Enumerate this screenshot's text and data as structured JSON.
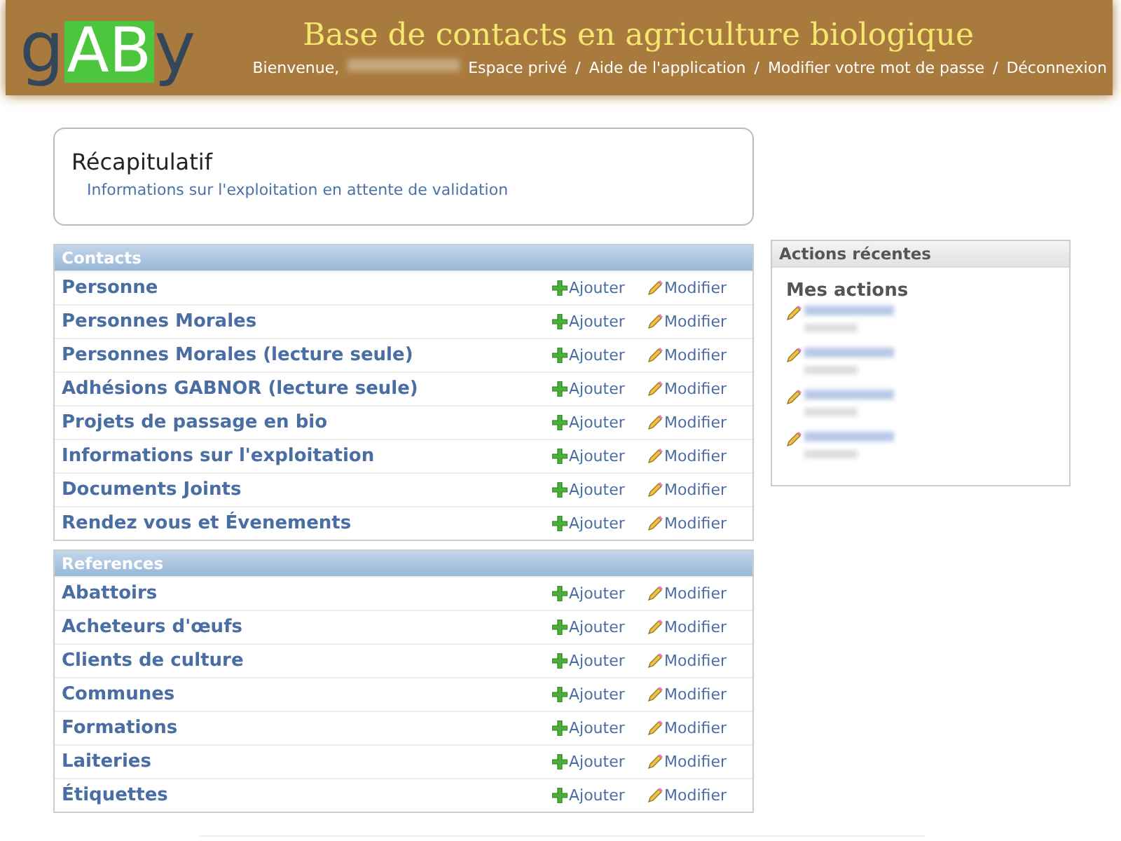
{
  "header": {
    "logo": {
      "letters": [
        "g",
        "AB",
        "y"
      ]
    },
    "title": "Base de contacts en agriculture biologique",
    "welcome": "Bienvenue,",
    "separator": "/",
    "links": [
      "Espace privé",
      "Aide de l'application",
      "Modifier votre mot de passe",
      "Déconnexion"
    ]
  },
  "summary": {
    "title": "Récapitulatif",
    "items": [
      "Informations sur l'exploitation en attente de validation"
    ]
  },
  "modules": [
    {
      "caption": "Contacts",
      "rows": [
        {
          "name": "Personne",
          "add": "Ajouter",
          "change": "Modifier"
        },
        {
          "name": "Personnes Morales",
          "add": "Ajouter",
          "change": "Modifier"
        },
        {
          "name": "Personnes Morales (lecture seule)",
          "add": "Ajouter",
          "change": "Modifier"
        },
        {
          "name": "Adhésions GABNOR (lecture seule)",
          "add": "Ajouter",
          "change": "Modifier"
        },
        {
          "name": "Projets de passage en bio",
          "add": "Ajouter",
          "change": "Modifier"
        },
        {
          "name": "Informations sur l'exploitation",
          "add": "Ajouter",
          "change": "Modifier"
        },
        {
          "name": "Documents Joints",
          "add": "Ajouter",
          "change": "Modifier"
        },
        {
          "name": "Rendez vous et Évenements",
          "add": "Ajouter",
          "change": "Modifier"
        }
      ]
    },
    {
      "caption": "References",
      "rows": [
        {
          "name": "Abattoirs",
          "add": "Ajouter",
          "change": "Modifier"
        },
        {
          "name": "Acheteurs d'œufs",
          "add": "Ajouter",
          "change": "Modifier"
        },
        {
          "name": "Clients de culture",
          "add": "Ajouter",
          "change": "Modifier"
        },
        {
          "name": "Communes",
          "add": "Ajouter",
          "change": "Modifier"
        },
        {
          "name": "Formations",
          "add": "Ajouter",
          "change": "Modifier"
        },
        {
          "name": "Laiteries",
          "add": "Ajouter",
          "change": "Modifier"
        },
        {
          "name": "Étiquettes",
          "add": "Ajouter",
          "change": "Modifier"
        }
      ]
    }
  ],
  "recent": {
    "caption": "Actions récentes",
    "heading": "Mes actions",
    "entries": [
      {
        "kind": "change"
      },
      {
        "kind": "change"
      },
      {
        "kind": "change"
      },
      {
        "kind": "change"
      }
    ]
  }
}
